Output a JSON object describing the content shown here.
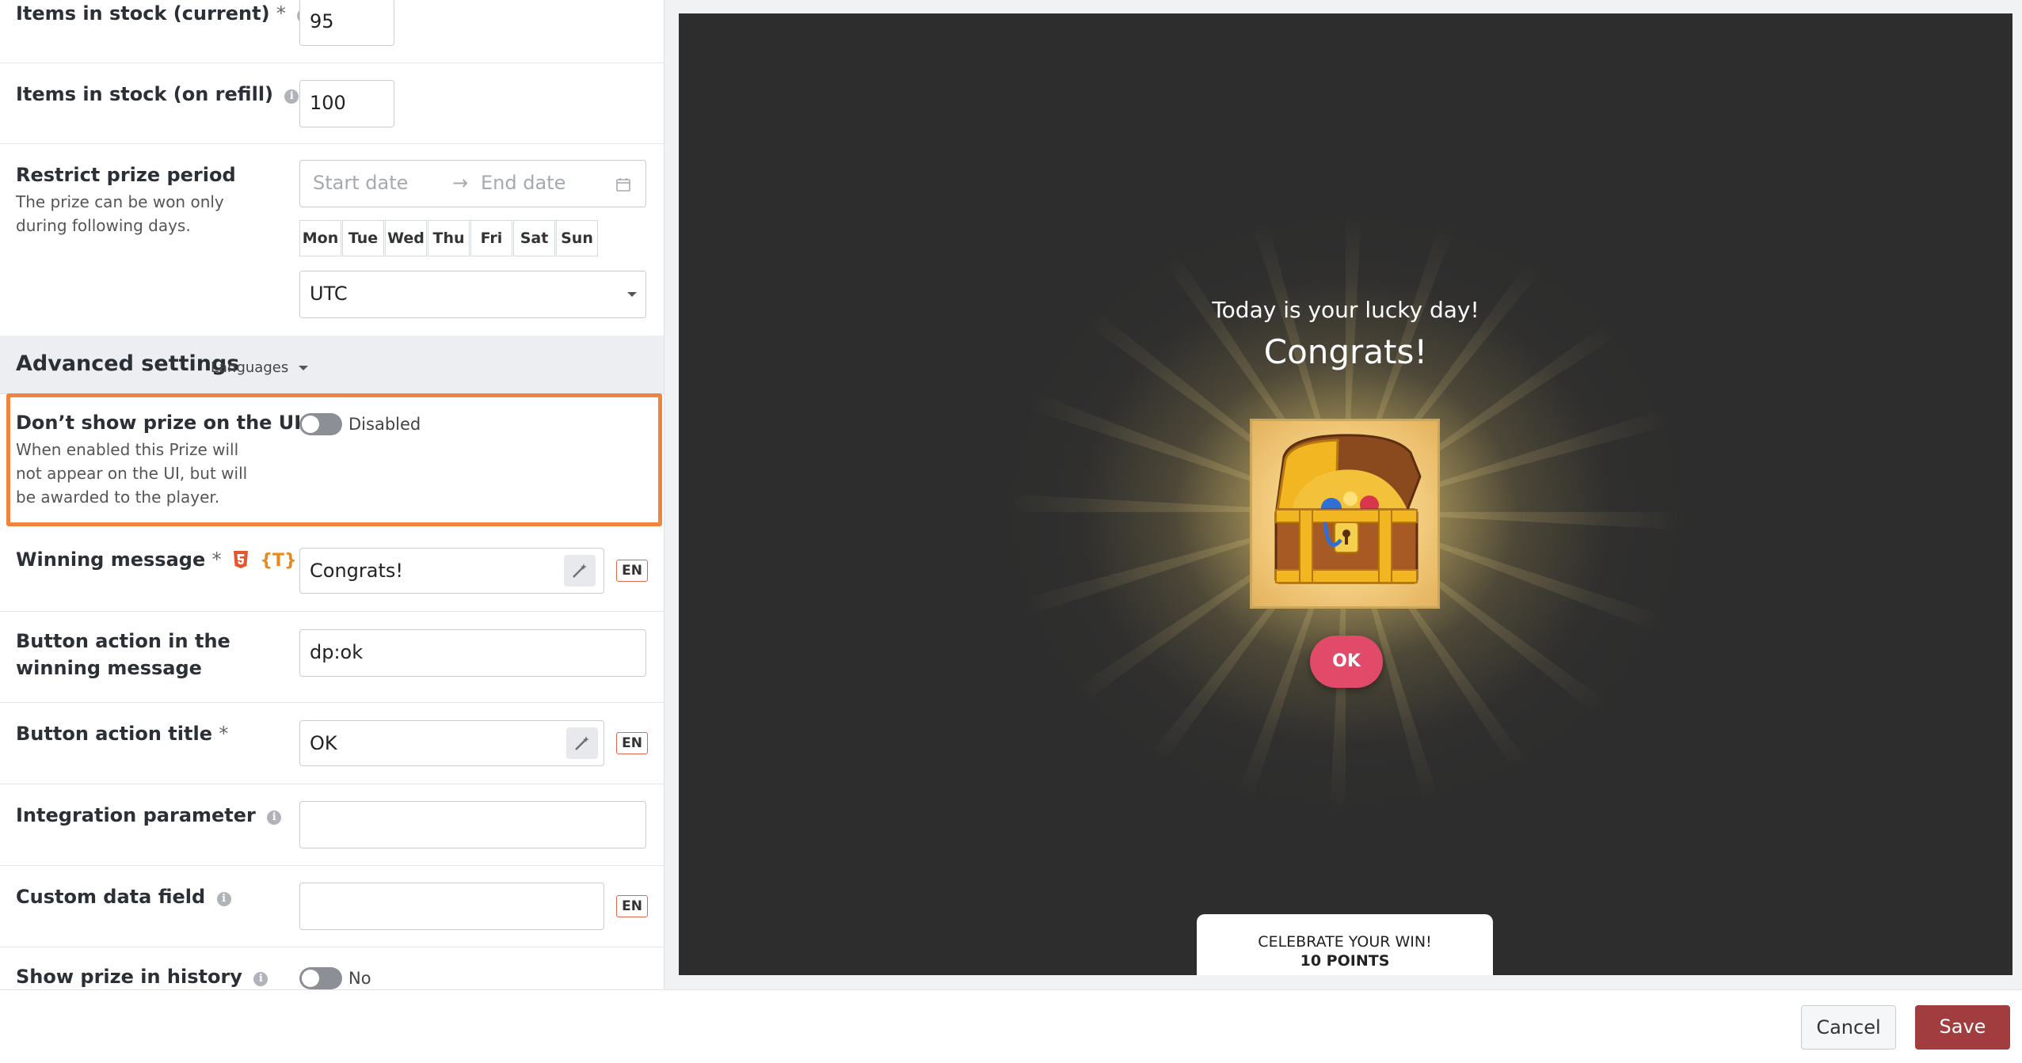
{
  "form": {
    "stock_current": {
      "label": "Items in stock (current)",
      "required": "*",
      "value": "95"
    },
    "stock_refill": {
      "label": "Items in stock (on refill)",
      "value": "100"
    },
    "restrict_period": {
      "label": "Restrict prize period",
      "description": "The prize can be won only during following days.",
      "start_placeholder": "Start date",
      "arrow": "→",
      "end_placeholder": "End date",
      "days": [
        "Mon",
        "Tue",
        "Wed",
        "Thu",
        "Fri",
        "Sat",
        "Sun"
      ],
      "timezone": "UTC"
    },
    "advanced": {
      "title": "Advanced settings",
      "languages_label": "Languages"
    },
    "dont_show": {
      "label": "Don’t show prize on the UI",
      "description": "When enabled this Prize will not appear on the UI, but will be awarded to the player.",
      "state_label": "Disabled"
    },
    "winning_message": {
      "label": "Winning message",
      "required": "*",
      "template_tag": "{T}",
      "value": "Congrats!",
      "lang": "EN"
    },
    "button_action": {
      "label": "Button action in the winning message",
      "value": "dp:ok"
    },
    "button_title": {
      "label": "Button action title",
      "required": "*",
      "value": "OK",
      "lang": "EN"
    },
    "integration_param": {
      "label": "Integration parameter",
      "value": ""
    },
    "custom_data": {
      "label": "Custom data field",
      "value": "",
      "lang": "EN"
    },
    "show_history": {
      "label": "Show prize in history",
      "state_label": "No"
    }
  },
  "preview": {
    "subtitle": "Today is your lucky day!",
    "title": "Congrats!",
    "ok_label": "OK",
    "celebrate_line1": "CELEBRATE YOUR WIN!",
    "celebrate_line2": "10 POINTS",
    "prize_image": "treasure-chest",
    "background_color": "#2d2d2d",
    "ok_color": "#e24a6a"
  },
  "footer": {
    "cancel_label": "Cancel",
    "save_label": "Save"
  },
  "colors": {
    "highlight": "#f0843c",
    "save": "#a13d3f",
    "en_badge_border": "#e2674e"
  }
}
